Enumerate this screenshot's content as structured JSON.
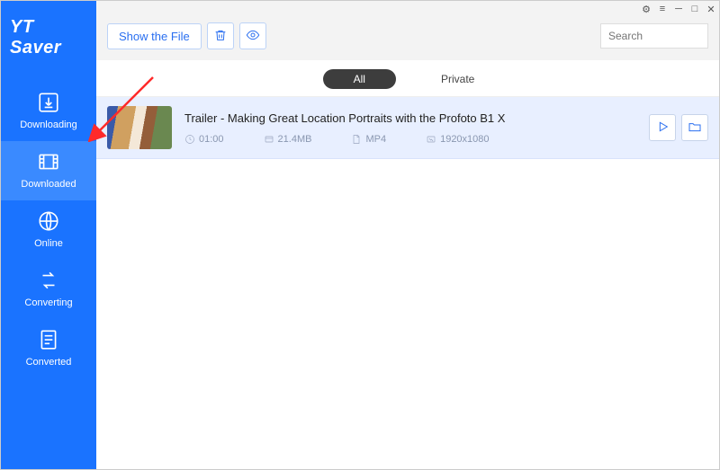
{
  "app": {
    "name": "YT Saver"
  },
  "sidebar": {
    "items": [
      {
        "label": "Downloading"
      },
      {
        "label": "Downloaded"
      },
      {
        "label": "Online"
      },
      {
        "label": "Converting"
      },
      {
        "label": "Converted"
      }
    ],
    "active_index": 1
  },
  "toolbar": {
    "show_file_label": "Show the File"
  },
  "search": {
    "placeholder": "Search"
  },
  "tabs": {
    "all": "All",
    "private": "Private"
  },
  "list": {
    "items": [
      {
        "title": "Trailer - Making Great Location Portraits with the Profoto B1 X",
        "duration": "01:00",
        "size": "21.4MB",
        "format": "MP4",
        "resolution": "1920x1080"
      }
    ]
  }
}
